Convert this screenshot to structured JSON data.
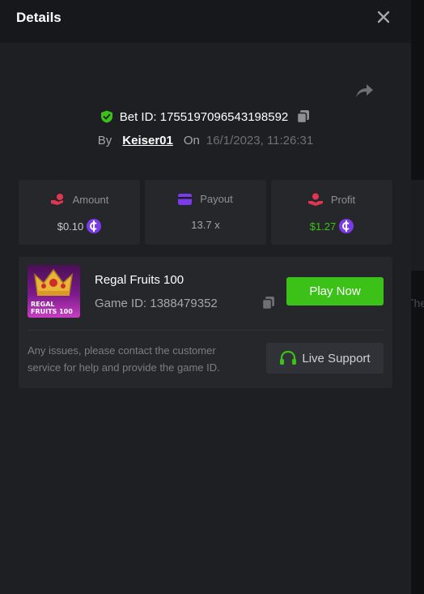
{
  "modal": {
    "title": "Details"
  },
  "bet": {
    "label": "Bet ID: 1755197096543198592",
    "by_label": "By",
    "username": "Keiser01",
    "on_label": "On",
    "date": "16/1/2023, 11:26:31"
  },
  "stats": {
    "amount": {
      "label": "Amount",
      "value": "$0.10",
      "color": "#c7c9cd"
    },
    "payout": {
      "label": "Payout",
      "value": "13.7 x",
      "color": "#a4a6ab"
    },
    "profit": {
      "label": "Profit",
      "value": "$1.27",
      "color": "#3bc117"
    }
  },
  "game": {
    "name": "Regal Fruits 100",
    "id_label": "Game ID: 1388479352",
    "thumb_text_1": "REGAL",
    "thumb_text_2": "FRUITS 100",
    "play_label": "Play Now"
  },
  "support": {
    "help_text": "Any issues, please contact the customer service for help and provide the game ID.",
    "button_label": "Live Support"
  },
  "backdrop": {
    "partial_text": "The"
  },
  "icons": {
    "close": "close-icon",
    "share": "share-icon",
    "shield": "shield-check-icon",
    "copy": "copy-icon",
    "amount": "hand-coin-icon",
    "payout": "wallet-icon",
    "profit": "profit-hand-icon",
    "coin": "coin-icon",
    "headset": "headset-icon"
  },
  "colors": {
    "accent_green": "#3bc117",
    "coin_purple": "#7c3aed",
    "amount_icon": "#e0364f",
    "payout_icon": "#7c3aed"
  }
}
